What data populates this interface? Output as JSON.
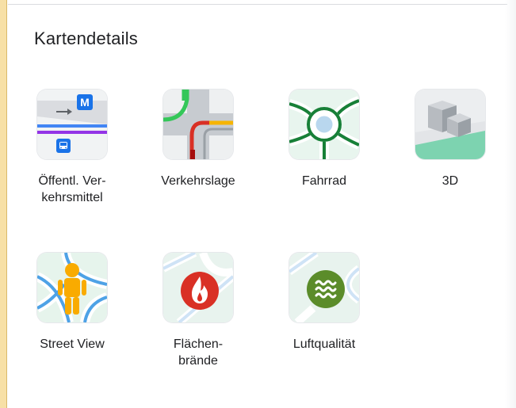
{
  "panel": {
    "title": "Kartendetails"
  },
  "tiles": [
    {
      "line1": "Öffentl. Ver-",
      "line2": "kehrsmittel",
      "icon": "transit-icon",
      "badge": "M"
    },
    {
      "line1": "Verkehrslage",
      "line2": "",
      "icon": "traffic-icon"
    },
    {
      "line1": "Fahrrad",
      "line2": "",
      "icon": "bicycle-icon"
    },
    {
      "line1": "3D",
      "line2": "",
      "icon": "3d-buildings-icon"
    },
    {
      "line1": "Street View",
      "line2": "",
      "icon": "street-view-icon"
    },
    {
      "line1": "Flächen-",
      "line2": "brände",
      "icon": "wildfire-icon"
    },
    {
      "line1": "Luftqualität",
      "line2": "",
      "icon": "air-quality-icon"
    }
  ],
  "colors": {
    "text": "#202124",
    "accent_blue": "#1a73e8",
    "traffic_green": "#34c759",
    "traffic_red": "#d93025",
    "traffic_yellow": "#f6b400",
    "bike_green": "#188038",
    "fire_red": "#d93025",
    "air_green": "#5b8c2a"
  }
}
